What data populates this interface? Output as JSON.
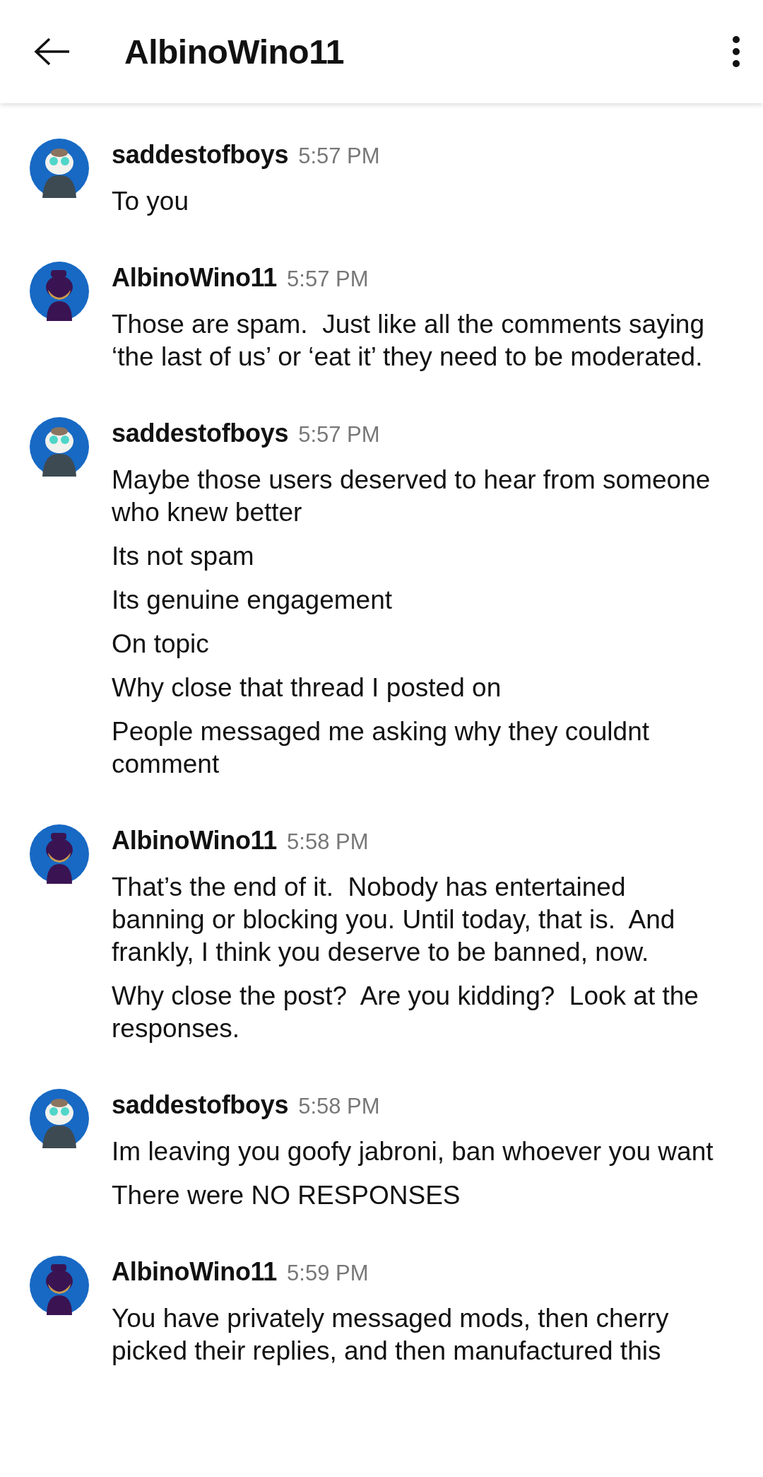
{
  "header": {
    "title": "AlbinoWino11"
  },
  "messages": [
    {
      "author": "saddestofboys",
      "avatar": {
        "kind": "light"
      },
      "time": "5:57 PM",
      "lines": [
        "To you"
      ]
    },
    {
      "author": "AlbinoWino11",
      "avatar": {
        "kind": "dark"
      },
      "time": "5:57 PM",
      "lines": [
        "Those are spam.  Just like all the comments saying ‘the last of us’ or ‘eat it’ they need to be moderated."
      ]
    },
    {
      "author": "saddestofboys",
      "avatar": {
        "kind": "light"
      },
      "time": "5:57 PM",
      "lines": [
        "Maybe those users deserved to hear from someone who knew better",
        "Its not spam",
        "Its genuine engagement",
        "On topic",
        "Why close that thread I posted on",
        "People messaged me asking why they couldnt comment"
      ]
    },
    {
      "author": "AlbinoWino11",
      "avatar": {
        "kind": "dark"
      },
      "time": "5:58 PM",
      "lines": [
        "That’s the end of it.  Nobody has entertained banning or blocking you. Until today, that is.  And frankly, I think you deserve to be banned, now.",
        "Why close the post?  Are you kidding?  Look at the responses."
      ]
    },
    {
      "author": "saddestofboys",
      "avatar": {
        "kind": "light"
      },
      "time": "5:58 PM",
      "lines": [
        "Im leaving you goofy jabroni, ban whoever you want",
        "There were NO RESPONSES"
      ]
    },
    {
      "author": "AlbinoWino11",
      "avatar": {
        "kind": "dark"
      },
      "time": "5:59 PM",
      "lines": [
        "You have privately messaged mods, then cherry picked their replies, and then manufactured this"
      ]
    }
  ]
}
